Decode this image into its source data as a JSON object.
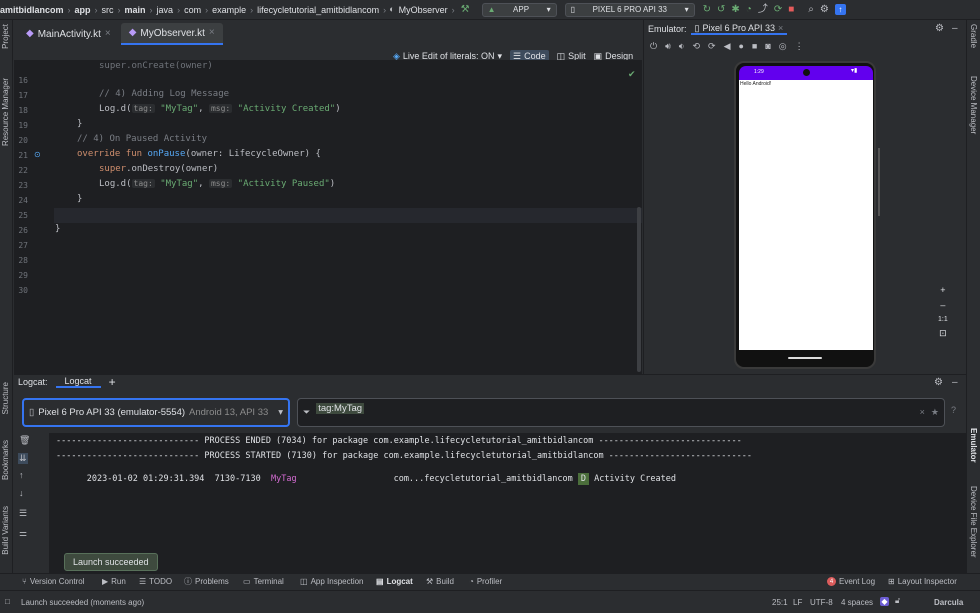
{
  "topbar": {
    "breadcrumbs": [
      "amitbidlancom",
      "app",
      "src",
      "main",
      "java",
      "com",
      "example",
      "lifecycletutorial_amitbidlancom",
      "MyObserver"
    ],
    "run_config": "APP",
    "device": "PIXEL 6 PRO API 33"
  },
  "editor_tabs": [
    {
      "label": "MainActivity.kt"
    },
    {
      "label": "MyObserver.kt"
    }
  ],
  "editor_toolbar": {
    "live_edit": "Live Edit of literals: ON",
    "code": "Code",
    "split": "Split",
    "design": "Design"
  },
  "code_lines": [
    {
      "n": "16",
      "text": "    super.onCreate(owner)"
    },
    {
      "n": "17",
      "text": ""
    },
    {
      "n": "18",
      "text": "    // 4) Adding Log Message"
    },
    {
      "n": "19",
      "text": "    Log.d("
    },
    {
      "n": "20",
      "text": "}"
    },
    {
      "n": "20b",
      "text": "// 4) On Paused Activity"
    },
    {
      "n": "21",
      "text": "override fun onPause(owner: LifecycleOwner) {"
    },
    {
      "n": "22",
      "text": "    super.onDestroy(owner)"
    },
    {
      "n": "23",
      "text": "    Log.d("
    },
    {
      "n": "24",
      "text": "}"
    },
    {
      "n": "25",
      "text": ""
    },
    {
      "n": "26",
      "text": "}"
    }
  ],
  "code": {
    "l16": "super.onCreate(owner)",
    "l18": "// 4) Adding Log Message",
    "l19_fn": "Log.d(",
    "l19_tag_hint": "tag:",
    "l19_tag": "\"MyTag\"",
    "l19_msg_hint": "msg:",
    "l19_msg": "\"Activity Created\"",
    "l19_end": ")",
    "l20": "}",
    "l20c": "// 4) On Paused Activity",
    "l21_override": "override",
    "l21_fun": "fun",
    "l21_name": "onPause",
    "l21_rest": "(owner: LifecycleOwner) {",
    "l22_super": "super",
    "l22_rest": ".onDestroy(owner)",
    "l23_fn": "Log.d(",
    "l23_tag_hint": "tag:",
    "l23_tag": "\"MyTag\"",
    "l23_msg_hint": "msg:",
    "l23_msg": "\"Activity Paused\"",
    "l23_end": ")",
    "l24": "}",
    "l26": "}"
  },
  "line_numbers": [
    "16",
    "17",
    "18",
    "19",
    "20",
    "21",
    "22",
    "23",
    "24",
    "25",
    "26",
    "27",
    "28",
    "29",
    "30"
  ],
  "emulator": {
    "title": "Emulator:",
    "device_tab": "Pixel 6 Pro API 33",
    "phone_time": "1:29",
    "phone_text": "Hello Android!",
    "zoom_ratio": "1:1"
  },
  "logcat": {
    "title": "Logcat:",
    "tab": "Logcat",
    "device_select": "Pixel 6 Pro API 33 (emulator-5554)",
    "device_detail": "Android 13, API 33",
    "filter": "tag:MyTag",
    "line1": "---------------------------- PROCESS ENDED (7034) for package com.example.lifecycletutorial_amitbidlancom ----------------------------",
    "line2": "---------------------------- PROCESS STARTED (7130) for package com.example.lifecycletutorial_amitbidlancom ----------------------------",
    "entry": {
      "timestamp": "2023-01-02 01:29:31.394",
      "pid": "7130-7130",
      "tag": "MyTag",
      "package": "com...fecycletutorial_amitbidlancom",
      "level": "D",
      "message": "Activity Created"
    }
  },
  "side_labels": {
    "project": "Project",
    "resource_manager": "Resource Manager",
    "structure": "Structure",
    "bookmarks": "Bookmarks",
    "build_variants": "Build Variants",
    "gradle": "Gradle",
    "device_manager": "Device Manager",
    "emulator": "Emulator",
    "device_file_explorer": "Device File Explorer"
  },
  "toolwindows": [
    "Version Control",
    "Run",
    "TODO",
    "Problems",
    "Terminal",
    "App Inspection",
    "Logcat",
    "Build",
    "Profiler"
  ],
  "event_log": {
    "count": "4",
    "label": "Event Log"
  },
  "layout_inspector": "Layout Inspector",
  "tooltip": "Launch succeeded",
  "status": {
    "message": "Launch succeeded (moments ago)",
    "position": "25:1",
    "line_sep": "LF",
    "encoding": "UTF-8",
    "indent": "4 spaces",
    "theme": "Darcula"
  }
}
